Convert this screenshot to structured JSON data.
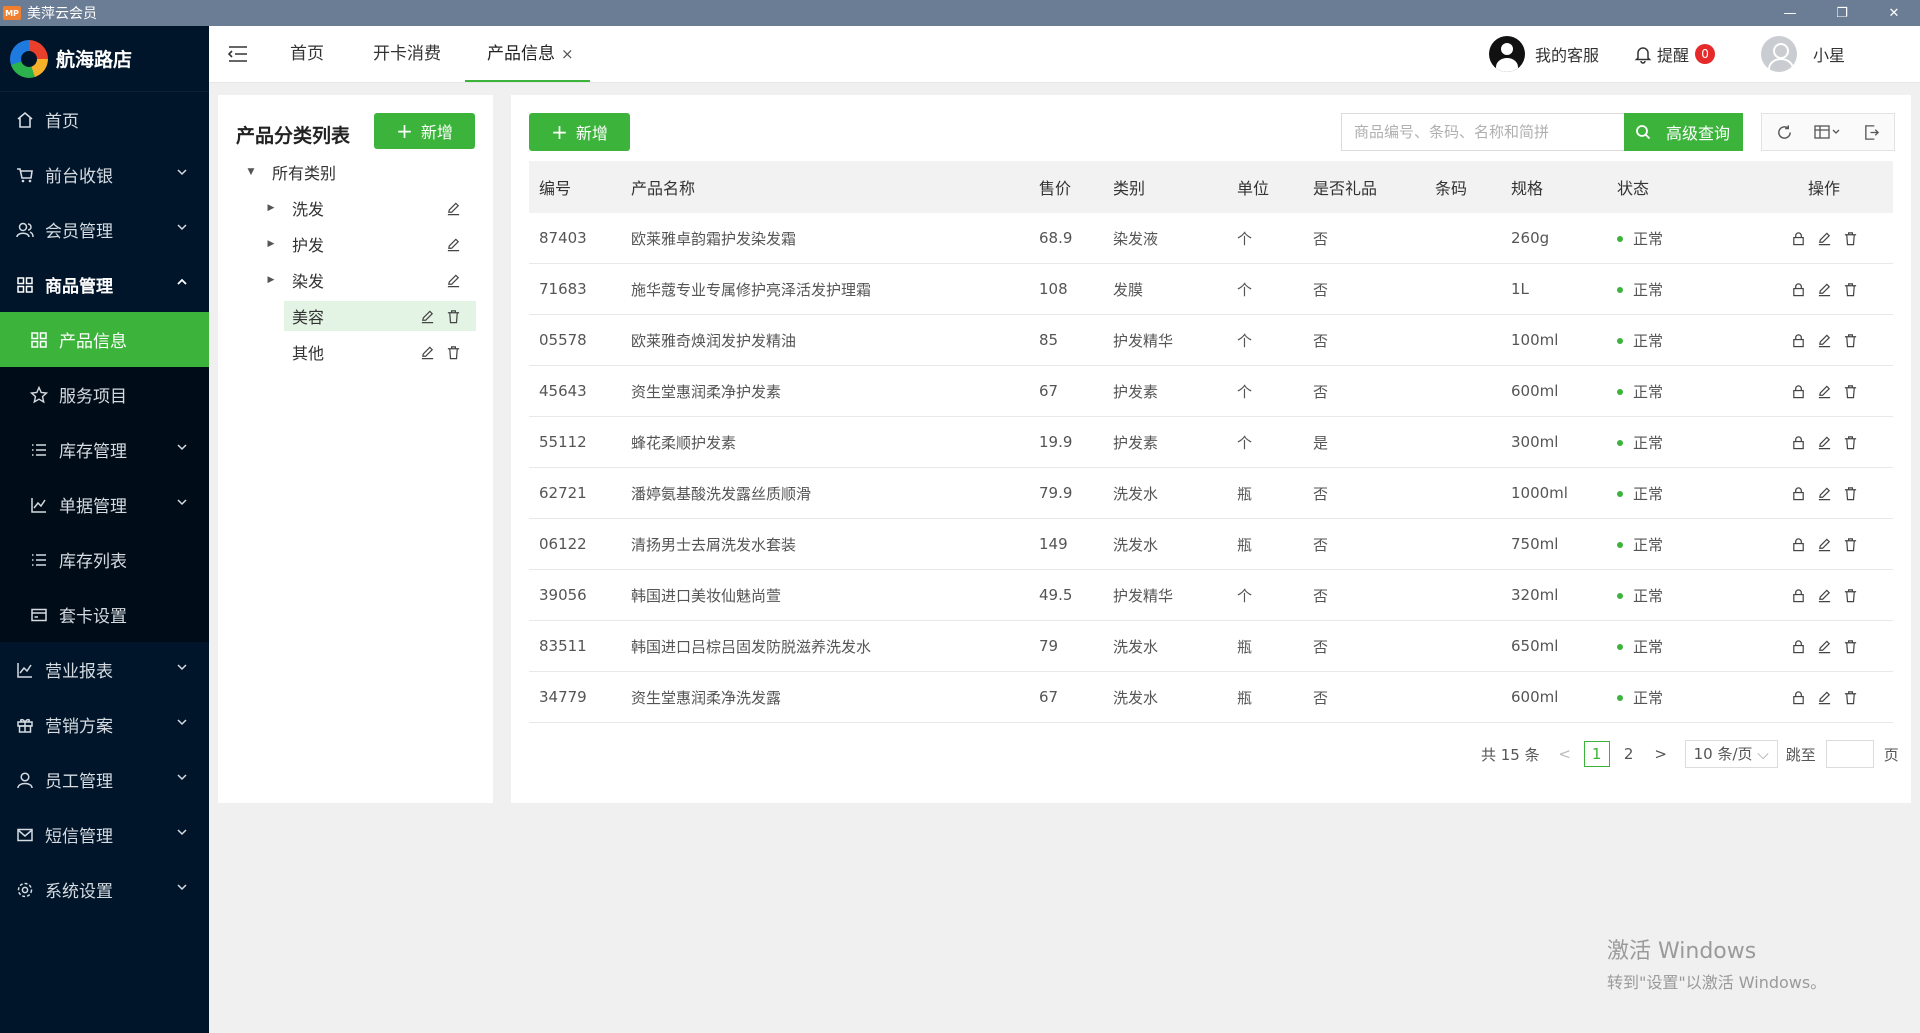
{
  "window": {
    "title": "美萍云会员",
    "app_icon_text": "MP",
    "controls": [
      "—",
      "❐",
      "✕"
    ]
  },
  "sidebar": {
    "brand": "航海路店",
    "items": [
      {
        "label": "首页",
        "icon": "home-icon"
      },
      {
        "label": "前台收银",
        "icon": "cart-icon"
      },
      {
        "label": "会员管理",
        "icon": "members-icon"
      },
      {
        "label": "商品管理",
        "icon": "grid-icon"
      },
      {
        "label": "产品信息",
        "icon": "grid-icon"
      },
      {
        "label": "服务项目",
        "icon": "star-icon"
      },
      {
        "label": "库存管理",
        "icon": "list-icon"
      },
      {
        "label": "单据管理",
        "icon": "chart-icon"
      },
      {
        "label": "库存列表",
        "icon": "list-icon"
      },
      {
        "label": "套卡设置",
        "icon": "card-icon"
      },
      {
        "label": "营业报表",
        "icon": "chart-icon"
      },
      {
        "label": "营销方案",
        "icon": "gift-icon"
      },
      {
        "label": "员工管理",
        "icon": "user-icon"
      },
      {
        "label": "短信管理",
        "icon": "mail-icon"
      },
      {
        "label": "系统设置",
        "icon": "gear-icon"
      }
    ]
  },
  "header": {
    "tabs": [
      {
        "label": "首页"
      },
      {
        "label": "开卡消费"
      },
      {
        "label": "产品信息",
        "close": "×"
      }
    ],
    "support": "我的客服",
    "reminder": "提醒",
    "reminder_count": "0",
    "user": "小星"
  },
  "category_panel": {
    "title": "产品分类列表",
    "add_label": "新增",
    "root": "所有类别",
    "items": [
      {
        "label": "洗发"
      },
      {
        "label": "护发"
      },
      {
        "label": "染发"
      },
      {
        "label": "美容"
      },
      {
        "label": "其他"
      }
    ]
  },
  "product_panel": {
    "add_label": "新增",
    "search_placeholder": "商品编号、条码、名称和简拼",
    "advanced_label": "高级查询",
    "columns": [
      "编号",
      "产品名称",
      "售价",
      "类别",
      "单位",
      "是否礼品",
      "条码",
      "规格",
      "状态",
      "操作"
    ],
    "rows": [
      {
        "id": "87403",
        "name": "欧莱雅卓韵霜护发染发霜",
        "price": "68.9",
        "category": "染发液",
        "unit": "个",
        "gift": "否",
        "barcode": "",
        "spec": "260g",
        "status": "正常"
      },
      {
        "id": "71683",
        "name": "施华蔻专业专属修护亮泽活发护理霜",
        "price": "108",
        "category": "发膜",
        "unit": "个",
        "gift": "否",
        "barcode": "",
        "spec": "1L",
        "status": "正常"
      },
      {
        "id": "05578",
        "name": "欧莱雅奇焕润发护发精油",
        "price": "85",
        "category": "护发精华",
        "unit": "个",
        "gift": "否",
        "barcode": "",
        "spec": "100ml",
        "status": "正常"
      },
      {
        "id": "45643",
        "name": "资生堂惠润柔净护发素",
        "price": "67",
        "category": "护发素",
        "unit": "个",
        "gift": "否",
        "barcode": "",
        "spec": "600ml",
        "status": "正常"
      },
      {
        "id": "55112",
        "name": "蜂花柔顺护发素",
        "price": "19.9",
        "category": "护发素",
        "unit": "个",
        "gift": "是",
        "barcode": "",
        "spec": "300ml",
        "status": "正常"
      },
      {
        "id": "62721",
        "name": "潘婷氨基酸洗发露丝质顺滑",
        "price": "79.9",
        "category": "洗发水",
        "unit": "瓶",
        "gift": "否",
        "barcode": "",
        "spec": "1000ml",
        "status": "正常"
      },
      {
        "id": "06122",
        "name": "清扬男士去屑洗发水套装",
        "price": "149",
        "category": "洗发水",
        "unit": "瓶",
        "gift": "否",
        "barcode": "",
        "spec": "750ml",
        "status": "正常"
      },
      {
        "id": "39056",
        "name": "韩国进口美妆仙魅尚萱",
        "price": "49.5",
        "category": "护发精华",
        "unit": "个",
        "gift": "否",
        "barcode": "",
        "spec": "320ml",
        "status": "正常"
      },
      {
        "id": "83511",
        "name": "韩国进口吕棕吕固发防脱滋养洗发水",
        "price": "79",
        "category": "洗发水",
        "unit": "瓶",
        "gift": "否",
        "barcode": "",
        "spec": "650ml",
        "status": "正常"
      },
      {
        "id": "34779",
        "name": "资生堂惠润柔净洗发露",
        "price": "67",
        "category": "洗发水",
        "unit": "瓶",
        "gift": "否",
        "barcode": "",
        "spec": "600ml",
        "status": "正常"
      }
    ],
    "pagination": {
      "total": "共 15 条",
      "prev": "<",
      "pages": [
        "1",
        "2"
      ],
      "next": ">",
      "page_size": "10 条/页",
      "jump_label": "跳至",
      "page_suffix": "页"
    }
  },
  "watermark": {
    "line1": "激活 Windows",
    "line2": "转到\"设置\"以激活 Windows。"
  },
  "colors": {
    "accent": "#3cb43c",
    "sidebar_bg": "#001529",
    "badge": "#e62a2a"
  }
}
